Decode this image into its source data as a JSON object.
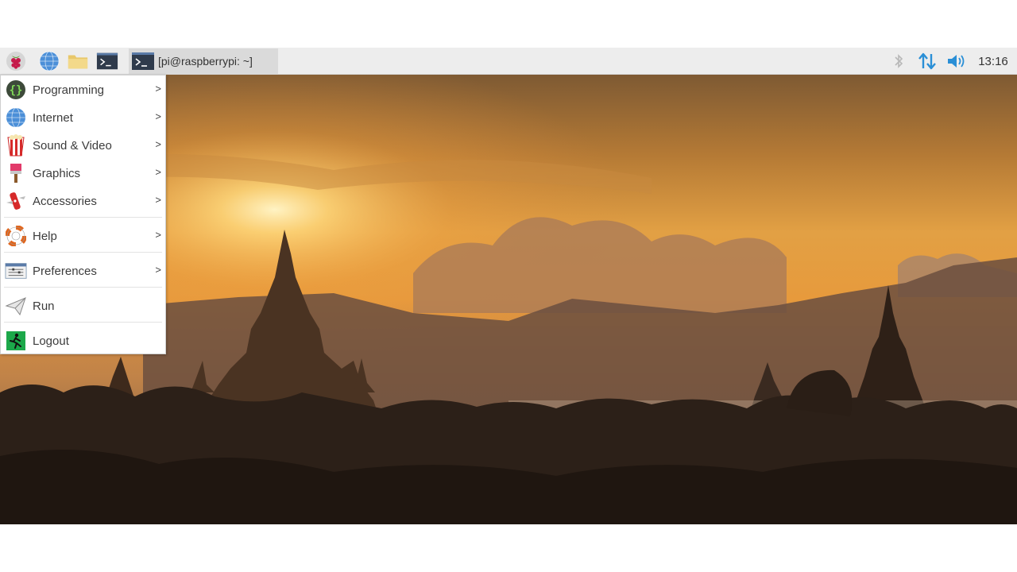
{
  "taskbar": {
    "launchers": [
      {
        "name": "raspberry-menu",
        "icon": "raspberry-icon"
      },
      {
        "name": "web-browser",
        "icon": "globe-icon"
      },
      {
        "name": "file-manager",
        "icon": "folder-icon"
      },
      {
        "name": "terminal",
        "icon": "terminal-icon"
      }
    ],
    "task_button": {
      "label": "[pi@raspberrypi: ~]",
      "icon": "terminal-icon"
    },
    "tray": {
      "bluetooth_icon": "bluetooth-icon",
      "network_icon": "network-updown-icon",
      "volume_icon": "volume-icon",
      "clock": "13:16"
    }
  },
  "menu": {
    "items": [
      {
        "label": "Programming",
        "icon": "programming-icon",
        "submenu": ">"
      },
      {
        "label": "Internet",
        "icon": "globe-icon",
        "submenu": ">"
      },
      {
        "label": "Sound & Video",
        "icon": "popcorn-icon",
        "submenu": ">"
      },
      {
        "label": "Graphics",
        "icon": "paintbrush-icon",
        "submenu": ">"
      },
      {
        "label": "Accessories",
        "icon": "multitool-icon",
        "submenu": ">"
      },
      {
        "label": "Help",
        "icon": "lifebuoy-icon",
        "submenu": ">"
      },
      {
        "label": "Preferences",
        "icon": "preferences-icon",
        "submenu": ">"
      },
      {
        "label": "Run",
        "icon": "paper-plane-icon"
      },
      {
        "label": "Logout",
        "icon": "exit-running-man-icon"
      }
    ]
  },
  "colors": {
    "taskbar_bg": "#ededed",
    "menu_bg": "#ffffff",
    "tray_accent": "#2a8fd6",
    "sky_top": "#8a5a2a",
    "sun": "#ffe9a8"
  }
}
